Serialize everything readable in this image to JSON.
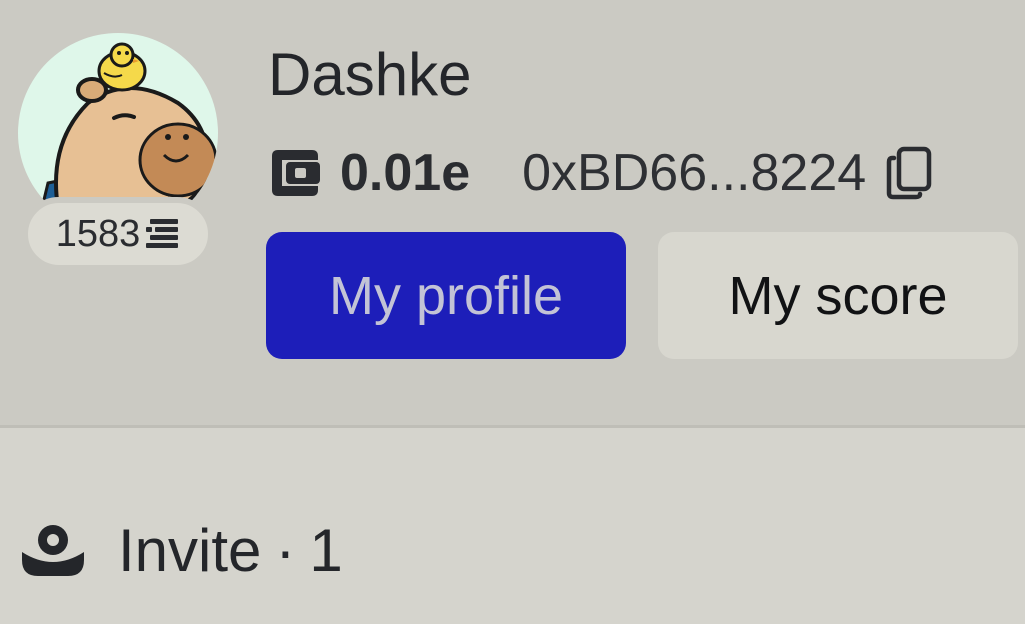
{
  "profile": {
    "username": "Dashke",
    "points": "1583",
    "points_icon": "stacked-bars-icon",
    "avatar_icon": "capybara-avatar-with-chick"
  },
  "wallet": {
    "icon": "wallet-icon",
    "balance": "0.01e",
    "address": "0xBD66...8224",
    "copy_icon": "copy-icon"
  },
  "actions": {
    "profile_label": "My profile",
    "score_label": "My score"
  },
  "invite": {
    "icon": "user-icon",
    "label": "Invite",
    "separator": "·",
    "count": "1"
  },
  "colors": {
    "primary": "#1d1eb9",
    "primary_text": "#c3c3d6",
    "header_bg": "#cbcac3",
    "page_bg": "#d5d4cd",
    "avatar_bg": "#dff7ea"
  }
}
